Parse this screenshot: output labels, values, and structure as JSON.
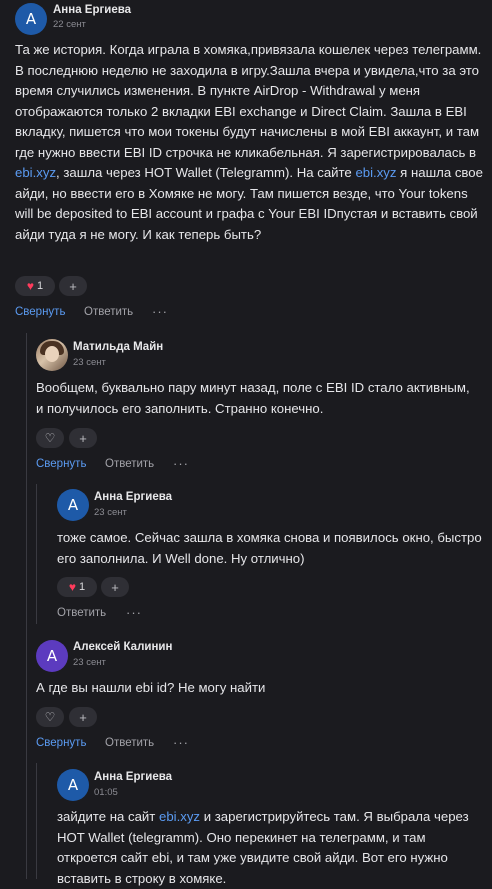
{
  "c1": {
    "avatar_letter": "А",
    "author": "Анна Ергиева",
    "date": "22 сент",
    "text_a": "Та же история. Когда играла в хомяка,привязала кошелек через телеграмм. В последнюю неделю не заходила в игру.Зашла вчера и увидела,что за это время случились изменения. В пункте AirDrop - Withdrawal у меня отображаются только 2 вкладки EBI exchange и Direct Claim. Зашла в EBI вкладку, пишется что мои токены будут начислены в мой EBI аккаунт, и там где нужно ввести EBI ID строчка не кликабельная. Я зарегистрировалась в ",
    "link_a": "ebi.xyz",
    "text_b": ", зашла через HOT Wallet (Telegramm). На сайте ",
    "link_b": "ebi.xyz",
    "text_c": " я нашла свое айди, но ввести его в Хомяке не могу. Там пишется везде, что Your tokens will be deposited to EBI account и графа с Your EBI IDпустая и вставить свой айди туда я не могу. И как теперь быть?",
    "likes": "1",
    "collapse": "Свернуть",
    "reply": "Ответить",
    "more": "···"
  },
  "c2": {
    "author": "Матильда Майн",
    "date": "23 сент",
    "text": "Вообщем, буквально пару минут назад, поле с EBI ID стало активным, и получилось его заполнить. Странно конечно.",
    "collapse": "Свернуть",
    "reply": "Ответить",
    "more": "···"
  },
  "c3": {
    "avatar_letter": "А",
    "author": "Анна Ергиева",
    "date": "23 сент",
    "text": "тоже самое. Сейчас зашла в хомяка снова и появилось окно, быстро его заполнила. И Well done. Ну отлично)",
    "likes": "1",
    "reply": "Ответить",
    "more": "···"
  },
  "c4": {
    "avatar_letter": "А",
    "author": "Алексей Калинин",
    "date": "23 сент",
    "text": "А где вы нашли ebi id? Не могу найти",
    "collapse": "Свернуть",
    "reply": "Ответить",
    "more": "···"
  },
  "c5": {
    "avatar_letter": "А",
    "author": "Анна Ергиева",
    "date": "01:05",
    "text_a": "зайдите на сайт ",
    "link_a": "ebi.xyz",
    "text_b": " и зарегистрируйтесь там. Я выбрала через HOT Wallet (telegramm). Оно перекинет на телеграмм, и там откроется сайт ebi, и там уже увидите свой айди. Вот его нужно вставить в строку в хомяке."
  },
  "colors": {
    "bg": "#1b1b1f",
    "link": "#5b9bf2",
    "avatar_blue": "#1e5aa8",
    "avatar_purple": "#5c3bbf",
    "heart": "#ff3b5c"
  },
  "icons": [
    "heart-icon",
    "plus-icon",
    "more-icon"
  ]
}
